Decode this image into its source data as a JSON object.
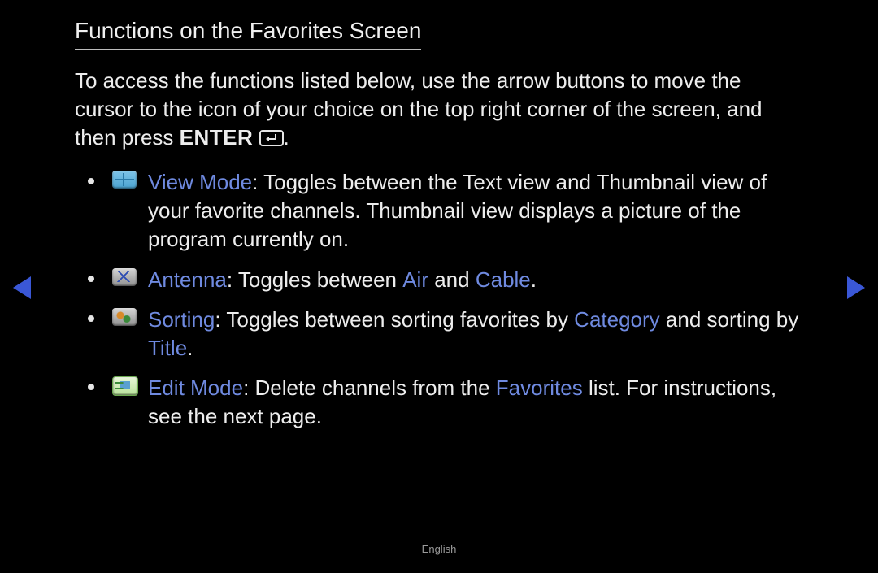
{
  "title": "Functions on the Favorites Screen",
  "intro": {
    "text_before": "To access the functions listed below, use the arrow buttons to move the cursor to the icon of your choice on the top right corner of the screen, and then press ",
    "enter_label": "ENTER",
    "period": "."
  },
  "items": [
    {
      "icon": "view-mode-icon",
      "label": "View Mode",
      "text_after_label": ": Toggles between the Text view and Thumbnail view of your favorite channels. Thumbnail view displays a picture of the program currently on."
    },
    {
      "icon": "antenna-icon",
      "label": "Antenna",
      "segments": [
        {
          "t": ": Toggles between ",
          "kw": false
        },
        {
          "t": "Air",
          "kw": true
        },
        {
          "t": " and ",
          "kw": false
        },
        {
          "t": "Cable",
          "kw": true
        },
        {
          "t": ".",
          "kw": false
        }
      ]
    },
    {
      "icon": "sorting-icon",
      "label": "Sorting",
      "segments": [
        {
          "t": ": Toggles between sorting favorites by ",
          "kw": false
        },
        {
          "t": "Category",
          "kw": true
        },
        {
          "t": " and sorting by ",
          "kw": false
        },
        {
          "t": "Title",
          "kw": true
        },
        {
          "t": ".",
          "kw": false
        }
      ]
    },
    {
      "icon": "edit-mode-icon",
      "label": "Edit Mode",
      "segments": [
        {
          "t": ": Delete channels from the ",
          "kw": false
        },
        {
          "t": "Favorites",
          "kw": true
        },
        {
          "t": " list. For instructions, see the next page.",
          "kw": false
        }
      ]
    }
  ],
  "footer": "English"
}
